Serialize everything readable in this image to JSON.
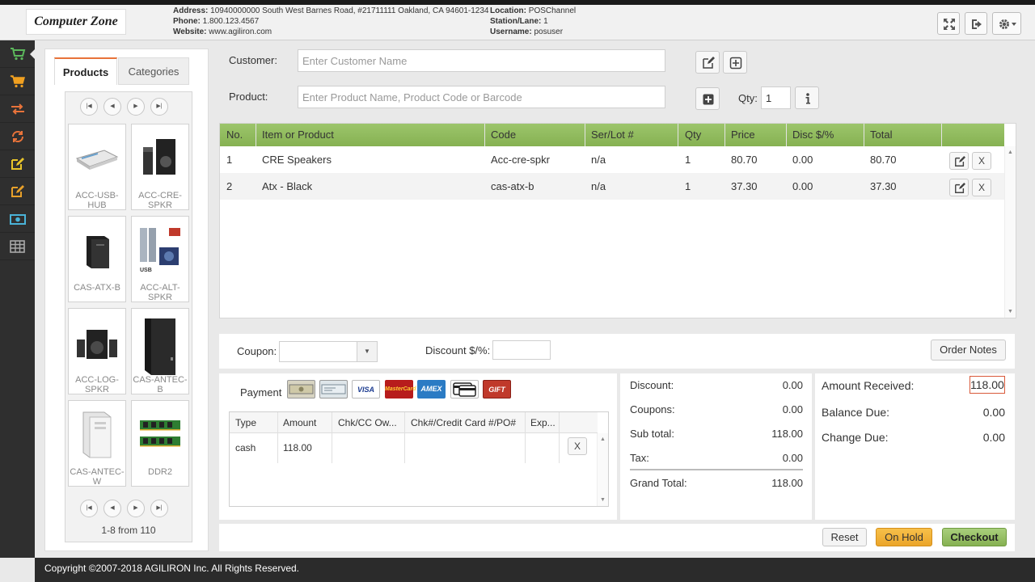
{
  "header": {
    "logo": "Computer Zone",
    "address_label": "Address:",
    "address": "10940000000 South West Barnes Road, #21711111 Oakland, CA 94601-1234",
    "phone_label": "Phone:",
    "phone": "1.800.123.4567",
    "website_label": "Website:",
    "website": "www.agiliron.com",
    "location_label": "Location:",
    "location": "POSChannel",
    "station_label": "Station/Lane:",
    "station": "1",
    "username_label": "Username:",
    "username": "posuser",
    "icons": [
      "fullscreen-icon",
      "logout-icon",
      "gear-icon"
    ]
  },
  "nav": {
    "items": [
      "cart-icon",
      "cart-icon",
      "exchange-icon",
      "refresh-icon",
      "edit-icon",
      "edit-icon",
      "cash-icon",
      "table-icon"
    ],
    "accent": "#e8a02a"
  },
  "products": {
    "tabs": [
      "Products",
      "Categories"
    ],
    "items": [
      "ACC-USB-HUB",
      "ACC-CRE-SPKR",
      "CAS-ATX-B",
      "ACC-ALT-SPKR",
      "ACC-LOG-SPKR",
      "CAS-ANTEC-B",
      "CAS-ANTEC-W",
      "DDR2"
    ],
    "pager_text": "1-8 from 110"
  },
  "form": {
    "customer_label": "Customer:",
    "customer_placeholder": "Enter Customer Name",
    "product_label": "Product:",
    "product_placeholder": "Enter Product Name, Product Code or Barcode",
    "qty_label": "Qty:",
    "qty_value": "1"
  },
  "items_table": {
    "headers": [
      "No.",
      "Item or Product",
      "Code",
      "Ser/Lot #",
      "Qty",
      "Price",
      "Disc $/%",
      "Total"
    ],
    "rows": [
      [
        "1",
        "CRE Speakers",
        "Acc-cre-spkr",
        "n/a",
        "1",
        "80.70",
        "0.00",
        "80.70"
      ],
      [
        "2",
        "Atx - Black",
        "cas-atx-b",
        "n/a",
        "1",
        "37.30",
        "0.00",
        "37.30"
      ]
    ],
    "remove_label": "X",
    "header_color": "#8fb95d"
  },
  "coupon": {
    "coupon_label": "Coupon:",
    "discount_label": "Discount $/%:",
    "order_notes": "Order Notes"
  },
  "payment": {
    "label": "Payment",
    "cards": [
      "",
      "",
      "VISA",
      "MasterCard",
      "AMEX",
      "",
      "GIFT"
    ],
    "headers": [
      "Type",
      "Amount",
      "Chk/CC Ow...",
      "Chk#/Credit Card #/PO#",
      "Exp..."
    ],
    "rows": [
      [
        "cash",
        "118.00",
        "",
        "",
        ""
      ]
    ],
    "remove_label": "X"
  },
  "totals": {
    "discount_label": "Discount:",
    "discount": "0.00",
    "coupons_label": "Coupons:",
    "coupons": "0.00",
    "subtotal_label": "Sub total:",
    "subtotal": "118.00",
    "tax_label": "Tax:",
    "tax": "0.00",
    "grand_label": "Grand Total:",
    "grand": "118.00"
  },
  "amounts": {
    "received_label": "Amount Received:",
    "received": "118.00",
    "balance_label": "Balance Due:",
    "balance": "0.00",
    "change_label": "Change Due:",
    "change": "0.00"
  },
  "actions": {
    "reset": "Reset",
    "onhold": "On Hold",
    "checkout": "Checkout"
  },
  "footer": {
    "copyright": "Copyright ©2007-2018 AGILIRON Inc. All Rights Reserved."
  }
}
